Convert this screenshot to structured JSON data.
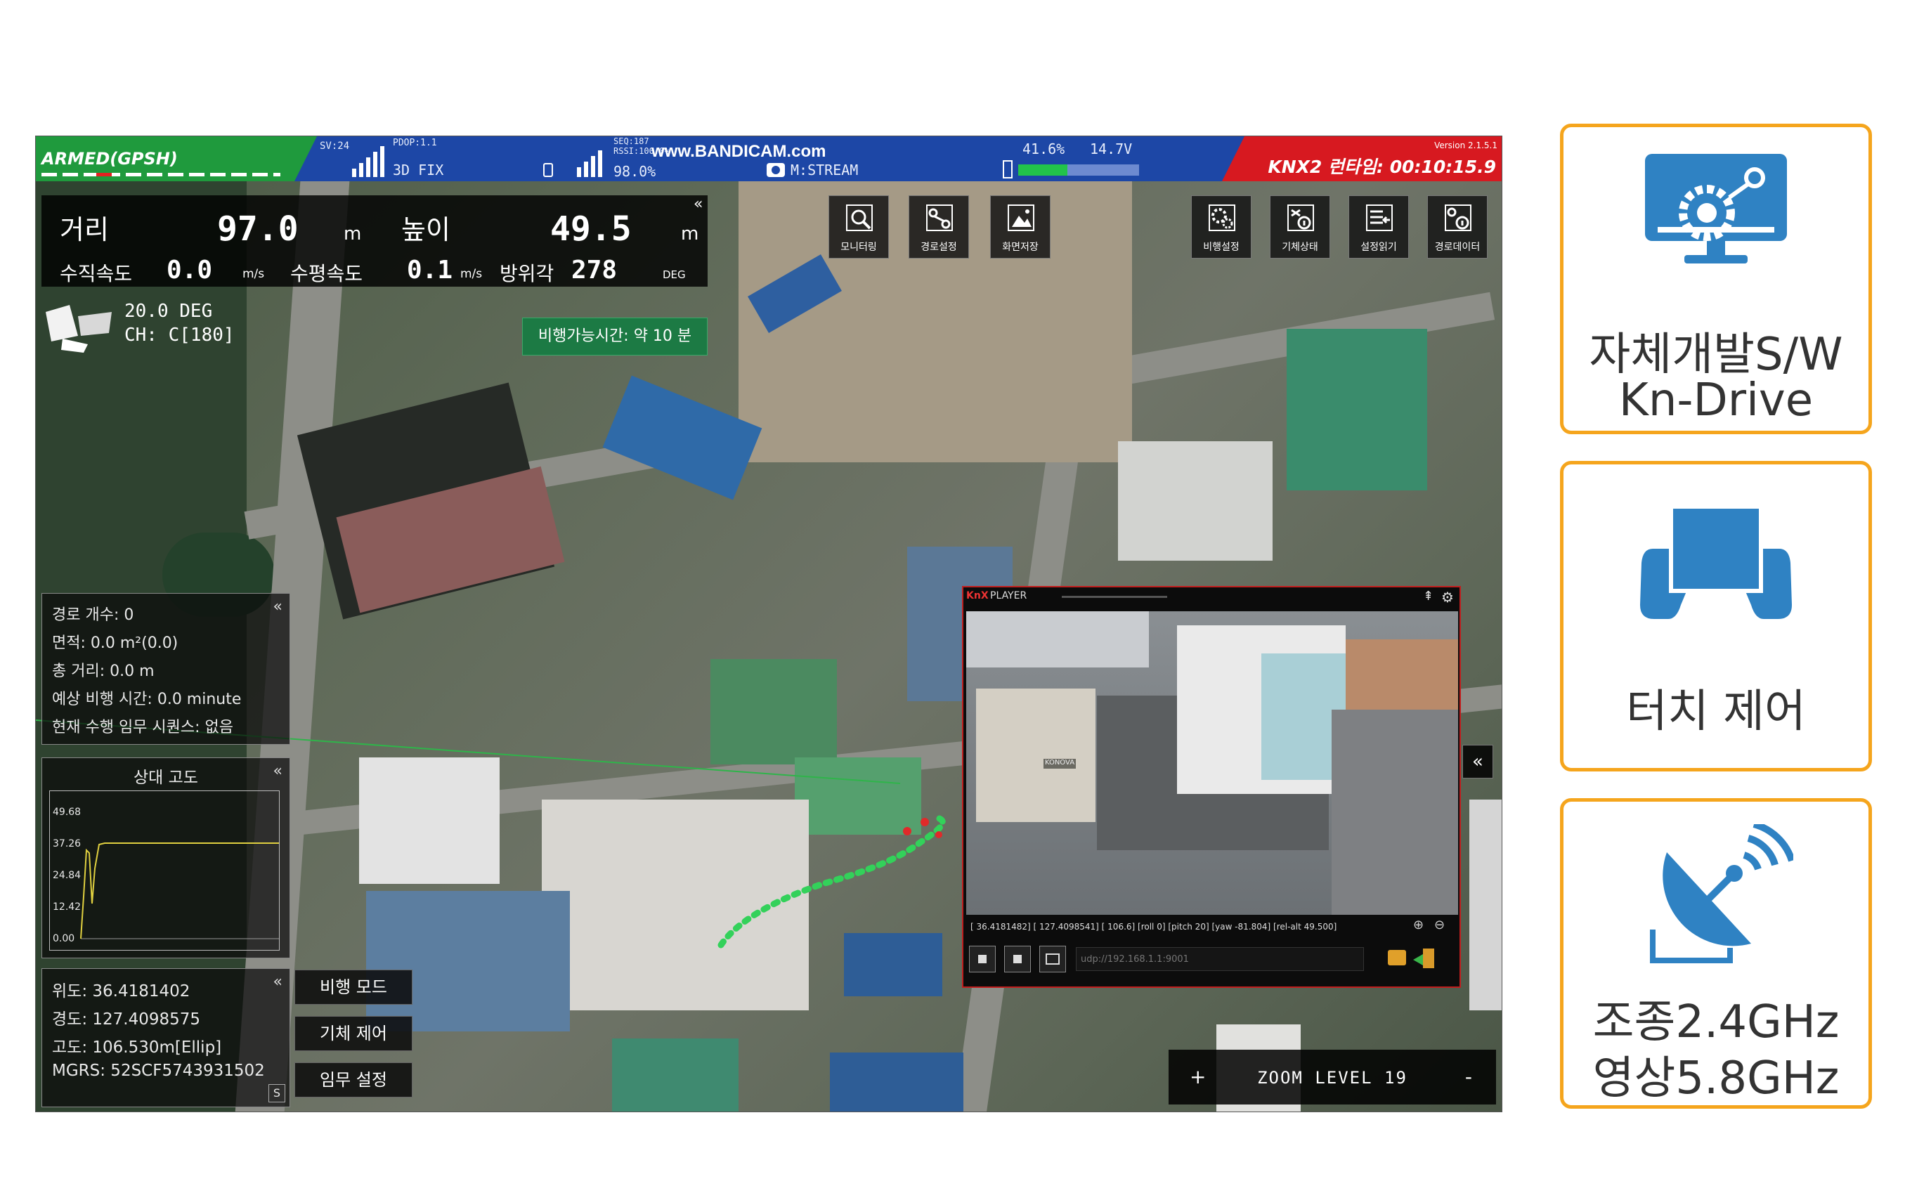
{
  "colors": {
    "brand_blue": "#2f82c3",
    "card_border": "#f5a51d",
    "status_green": "#1f9a3d",
    "status_red": "#d71920",
    "status_blue": "#1d47a6"
  },
  "status_bar": {
    "mode": "ARMED(GPSH)",
    "sv": "SV:24",
    "pdop": "PDOP:1.1",
    "fix": "3D FIX",
    "seq": "SEQ:187",
    "rssi": "RSSI:100.0%",
    "watermark": "www.BANDICAM.com",
    "link": "98.0%",
    "stream": "M:STREAM",
    "battery_percent": "41.6%",
    "voltage": "14.7V",
    "version": "Version 2.1.5.1",
    "runtime": "KNX2 런타임: 00:10:15.9"
  },
  "telemetry": {
    "distance_label": "거리",
    "distance_value": "97.0",
    "distance_unit": "m",
    "height_label": "높이",
    "height_value": "49.5",
    "height_unit": "m",
    "vspeed_label": "수직속도",
    "vspeed_value": "0.0",
    "vspeed_unit": "m/s",
    "hspeed_label": "수평속도",
    "hspeed_value": "0.1",
    "hspeed_unit": "m/s",
    "heading_label": "방위각",
    "heading_value": "278",
    "heading_unit": "DEG"
  },
  "gimbal": {
    "angle": "20.0 DEG",
    "channel": "CH: C[180]"
  },
  "toolbar": [
    {
      "label": "모니터링",
      "icon": "monitoring-icon"
    },
    {
      "label": "경로설정",
      "icon": "route-icon"
    },
    {
      "label": "화면저장",
      "icon": "screenshot-icon"
    },
    {
      "label": "비행설정",
      "icon": "flight-settings-icon"
    },
    {
      "label": "기체상태",
      "icon": "vehicle-status-icon"
    },
    {
      "label": "설정읽기",
      "icon": "read-settings-icon"
    },
    {
      "label": "경로데이터",
      "icon": "route-data-icon"
    }
  ],
  "flight_time": "비행가능시간: 약 10 분",
  "route_panel": {
    "count": "경로 개수: 0",
    "area": "면적: 0.0 m²(0.0)",
    "total_distance": "총 거리: 0.0 m",
    "eta": "예상 비행 시간: 0.0 minute",
    "sequence": "현재 수행 임무 시퀀스: 없음"
  },
  "altitude_chart": {
    "title": "상대 고도",
    "ticks": [
      "49.68",
      "37.26",
      "24.84",
      "12.42",
      "0.00"
    ]
  },
  "position_panel": {
    "lat": "위도:  36.4181402",
    "lon": "경도:  127.4098575",
    "alt": "고도:  106.530m[Ellip]",
    "mgrs": "MGRS: 52SCF5743931502",
    "badge": "S"
  },
  "mode_buttons": {
    "flight_mode": "비행 모드",
    "vehicle_control": "기체 제어",
    "mission_settings": "임무 설정"
  },
  "zoom": {
    "plus": "+",
    "label": "ZOOM LEVEL 19",
    "minus": "-"
  },
  "player": {
    "brand": "KnX",
    "title": "PLAYER",
    "status_line": "[ 36.4181482] [ 127.4098541] [ 106.6] [roll 0] [pitch 20] [yaw -81.804] [rel-alt 49.500]",
    "url_placeholder": "udp://192.168.1.1:9001",
    "building_sign": "KONOVA"
  },
  "side_collapse": "«",
  "features": [
    {
      "icon": "monitor-gear-icon",
      "lines": [
        "자체개발S/W",
        "Kn-Drive"
      ]
    },
    {
      "icon": "tablet-controller-icon",
      "lines": [
        "터치 제어"
      ]
    },
    {
      "icon": "satellite-dish-icon",
      "lines": [
        "조종2.4GHz",
        "영상5.8GHz"
      ]
    }
  ]
}
